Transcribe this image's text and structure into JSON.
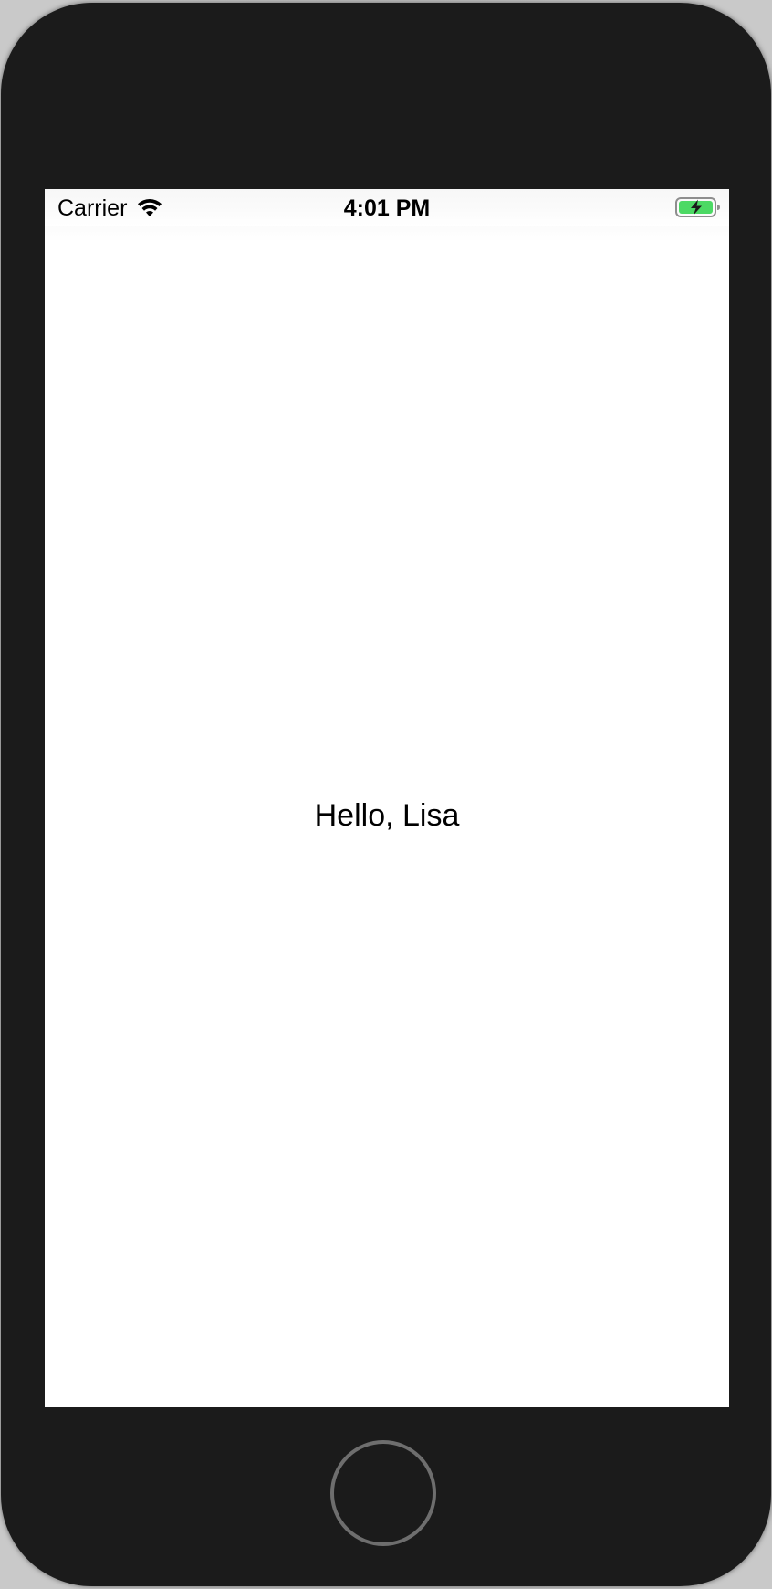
{
  "status_bar": {
    "carrier": "Carrier",
    "time": "4:01 PM",
    "icons": [
      "wifi-icon",
      "battery-charging-icon"
    ],
    "battery_color": "#4cd964"
  },
  "content": {
    "greeting": "Hello, Lisa"
  },
  "device": {
    "frame_color": "#1b1b1b",
    "home_button": "home-button"
  }
}
